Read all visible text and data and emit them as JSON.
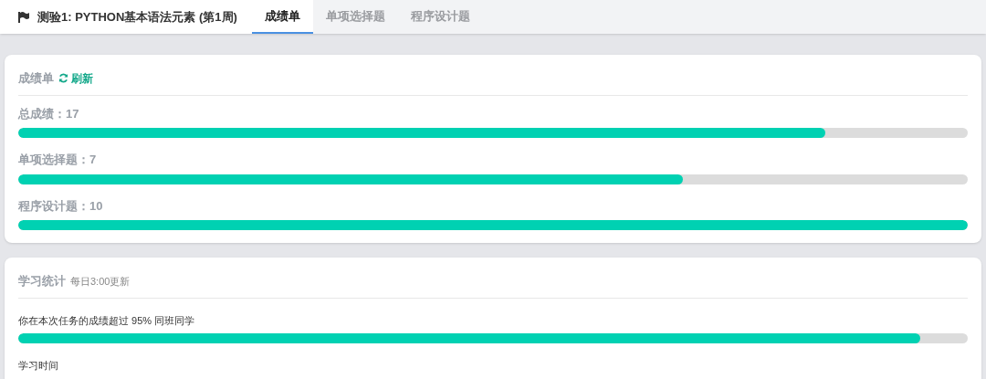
{
  "header": {
    "title": "测验1: PYTHON基本语法元素 (第1周)"
  },
  "tabs": [
    {
      "label": "成绩单",
      "selected": true
    },
    {
      "label": "单项选择题",
      "selected": false
    },
    {
      "label": "程序设计题",
      "selected": false
    }
  ],
  "scores": {
    "title": "成绩单",
    "refresh": "刷新",
    "items": [
      {
        "label": "总成绩：17",
        "level": 0.85
      },
      {
        "label": "单项选择题：7",
        "level": 0.7
      },
      {
        "label": "程序设计题：10",
        "level": 1
      }
    ]
  },
  "stats": {
    "title": "学习统计",
    "note": "每日3:00更新",
    "items": [
      {
        "label": "你在本次任务的成绩超过 95% 同班同学",
        "level": 0.95
      }
    ],
    "next_label": "学习时间"
  }
}
